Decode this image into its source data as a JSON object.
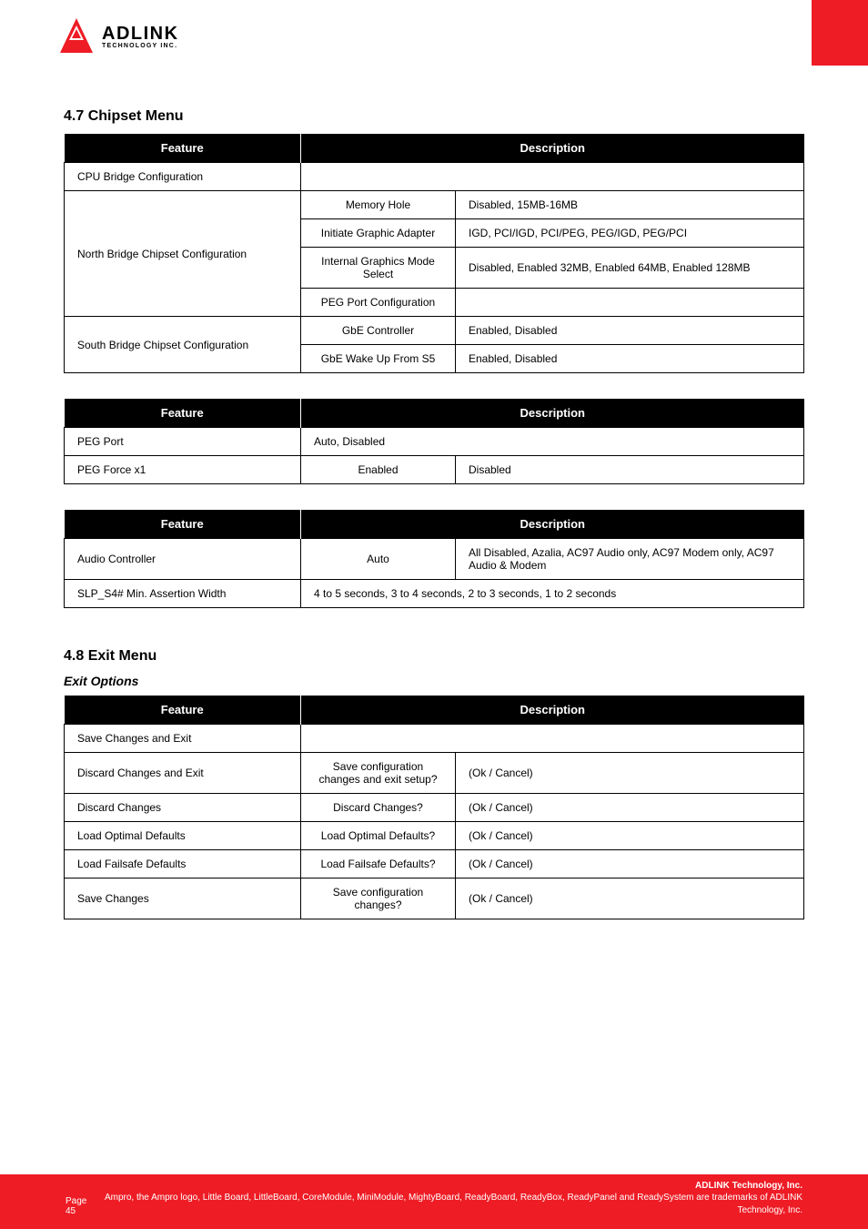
{
  "logo": {
    "brand": "ADLINK",
    "sub": "TECHNOLOGY INC."
  },
  "s1": {
    "title": "4.7 Chipset Menu"
  },
  "t1": {
    "h": [
      "Feature",
      "Description"
    ],
    "rows": [
      [
        "CPU Bridge Configuration",
        "",
        "",
        true
      ],
      [
        "North Bridge Chipset Configuration",
        "Memory Hole",
        "Disabled, 15MB-16MB",
        false
      ],
      [
        "",
        "Initiate Graphic Adapter",
        "IGD, PCI/IGD, PCI/PEG, PEG/IGD, PEG/PCI",
        false
      ],
      [
        "",
        "Internal Graphics Mode Select",
        "Disabled, Enabled 32MB, Enabled 64MB, Enabled 128MB",
        false
      ],
      [
        "",
        "PEG Port Configuration",
        "",
        false
      ],
      [
        "South Bridge Chipset Configuration",
        "GbE Controller",
        "Enabled, Disabled",
        false
      ],
      [
        "",
        "GbE Wake Up From S5",
        "Enabled, Disabled",
        false
      ]
    ]
  },
  "t2": {
    "h": [
      "Feature",
      "Description"
    ],
    "rows": [
      [
        "PEG Port",
        "",
        "Auto, Disabled",
        true
      ],
      [
        "PEG Force x1",
        "Enabled",
        "Disabled",
        false
      ]
    ]
  },
  "t3": {
    "h": [
      "Feature",
      "Description"
    ],
    "rows": [
      [
        "Audio Controller",
        "Auto",
        "All Disabled, Azalia, AC97 Audio only, AC97 Modem only, AC97 Audio & Modem",
        false
      ],
      [
        "SLP_S4# Min. Assertion Width",
        "",
        "4 to 5 seconds, 3 to 4 seconds, 2 to 3 seconds, 1 to 2 seconds",
        true
      ]
    ]
  },
  "s2": {
    "title": "4.8 Exit Menu",
    "sub": "Exit Options"
  },
  "t4": {
    "h": [
      "Feature",
      "Description"
    ],
    "rows": [
      [
        "Save Changes and Exit",
        "",
        "",
        true
      ],
      [
        "Discard Changes and Exit",
        "Save configuration changes and exit setup?",
        "(Ok / Cancel)",
        false
      ],
      [
        "Discard Changes",
        "Discard Changes?",
        "(Ok / Cancel)",
        false
      ],
      [
        "Load Optimal Defaults",
        "Load Optimal Defaults?",
        "(Ok / Cancel)",
        false
      ],
      [
        "Load Failsafe Defaults",
        "Load Failsafe Defaults?",
        "(Ok / Cancel)",
        false
      ],
      [
        "Save Changes",
        "Save configuration changes?",
        "(Ok / Cancel)",
        false
      ]
    ]
  },
  "footer": {
    "page": "Page 45",
    "line1": "ADLINK Technology, Inc.",
    "line2": "Ampro, the Ampro logo, Little Board, LittleBoard, CoreModule, MiniModule, MightyBoard, ReadyBoard, ReadyBox, ReadyPanel and ReadySystem are trademarks of ADLINK Technology, Inc."
  }
}
